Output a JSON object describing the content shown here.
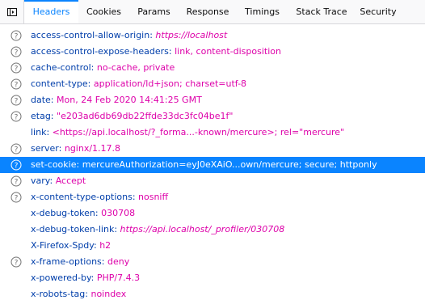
{
  "toolbar": {
    "panel_toggle_icon": "panel-toggle-icon",
    "tabs": [
      {
        "label": "Headers",
        "selected": true
      },
      {
        "label": "Cookies",
        "selected": false
      },
      {
        "label": "Params",
        "selected": false
      },
      {
        "label": "Response",
        "selected": false
      },
      {
        "label": "Timings",
        "selected": false
      },
      {
        "label": "Stack Trace",
        "selected": false
      },
      {
        "label": "Security",
        "selected": false
      }
    ]
  },
  "headers": [
    {
      "name": "access-control-allow-origin:",
      "value": "https://localhost",
      "italic": true,
      "help": true
    },
    {
      "name": "access-control-expose-headers:",
      "value": "link, content-disposition",
      "italic": false,
      "help": true
    },
    {
      "name": "cache-control:",
      "value": "no-cache, private",
      "italic": false,
      "help": true
    },
    {
      "name": "content-type:",
      "value": "application/ld+json; charset=utf-8",
      "italic": false,
      "help": true
    },
    {
      "name": "date:",
      "value": "Mon, 24 Feb 2020 14:41:25 GMT",
      "italic": false,
      "help": true
    },
    {
      "name": "etag:",
      "value": "\"e203ad6db69db22ffde33dc3fc04be1f\"",
      "italic": false,
      "help": true
    },
    {
      "name": "link:",
      "value": "<https://api.localhost/?_forma...-known/mercure>; rel=\"mercure\"",
      "italic": false,
      "help": false
    },
    {
      "name": "server:",
      "value": "nginx/1.17.8",
      "italic": false,
      "help": true
    },
    {
      "name": "set-cookie:",
      "value": "mercureAuthorization=eyJ0eXAiO...own/mercure; secure; httponly",
      "italic": false,
      "help": true,
      "selected": true
    },
    {
      "name": "vary:",
      "value": "Accept",
      "italic": false,
      "help": true
    },
    {
      "name": "x-content-type-options:",
      "value": "nosniff",
      "italic": false,
      "help": true
    },
    {
      "name": "x-debug-token:",
      "value": "030708",
      "italic": false,
      "help": false
    },
    {
      "name": "x-debug-token-link:",
      "value": "https://api.localhost/_profiler/030708",
      "italic": true,
      "help": false
    },
    {
      "name": "X-Firefox-Spdy:",
      "value": "h2",
      "italic": false,
      "help": false
    },
    {
      "name": "x-frame-options:",
      "value": "deny",
      "italic": false,
      "help": true
    },
    {
      "name": "x-powered-by:",
      "value": "PHP/7.4.3",
      "italic": false,
      "help": false
    },
    {
      "name": "x-robots-tag:",
      "value": "noindex",
      "italic": false,
      "help": false
    }
  ],
  "colors": {
    "selected_tab": "#0a84ff",
    "header_name": "#003eaa",
    "header_value": "#dd00a9",
    "selected_row": "#0a84ff"
  }
}
